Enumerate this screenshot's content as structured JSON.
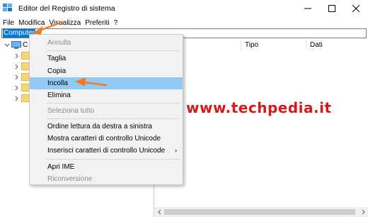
{
  "window": {
    "title": "Editor del Registro di sistema",
    "controls": [
      "minimize-icon",
      "maximize-icon",
      "close-icon"
    ]
  },
  "menubar": {
    "items": [
      "File",
      "Modifica",
      "Visualizza",
      "Preferiti",
      "?"
    ]
  },
  "address": {
    "value": "Computer"
  },
  "tree": {
    "root_label": "C",
    "root_icon": "computer-icon",
    "child_count": 5
  },
  "list": {
    "columns": [
      "Tipo",
      "Dati"
    ]
  },
  "watermark": "www.techpedia.it",
  "context_menu": {
    "items": [
      {
        "label": "Annulla",
        "enabled": false
      },
      {
        "label": "Taglia",
        "enabled": true
      },
      {
        "label": "Copia",
        "enabled": true
      },
      {
        "label": "Incolla",
        "enabled": true,
        "highlighted": true
      },
      {
        "label": "Elimina",
        "enabled": true
      },
      {
        "label": "Seleziona tutto",
        "enabled": false
      },
      {
        "label": "Ordine lettura da destra a sinistra",
        "enabled": true
      },
      {
        "label": "Mostra caratteri di controllo Unicode",
        "enabled": true
      },
      {
        "label": "Inserisci caratteri di controllo Unicode",
        "enabled": true,
        "submenu": true
      },
      {
        "label": "Apri IME",
        "enabled": true
      },
      {
        "label": "Riconversione",
        "enabled": false
      }
    ],
    "submenu_glyph": "›"
  },
  "colors": {
    "selection": "#0078d7",
    "menu_highlight": "#91c9f7",
    "arrow_orange": "#f07b22",
    "watermark_red": "#d7191c"
  }
}
